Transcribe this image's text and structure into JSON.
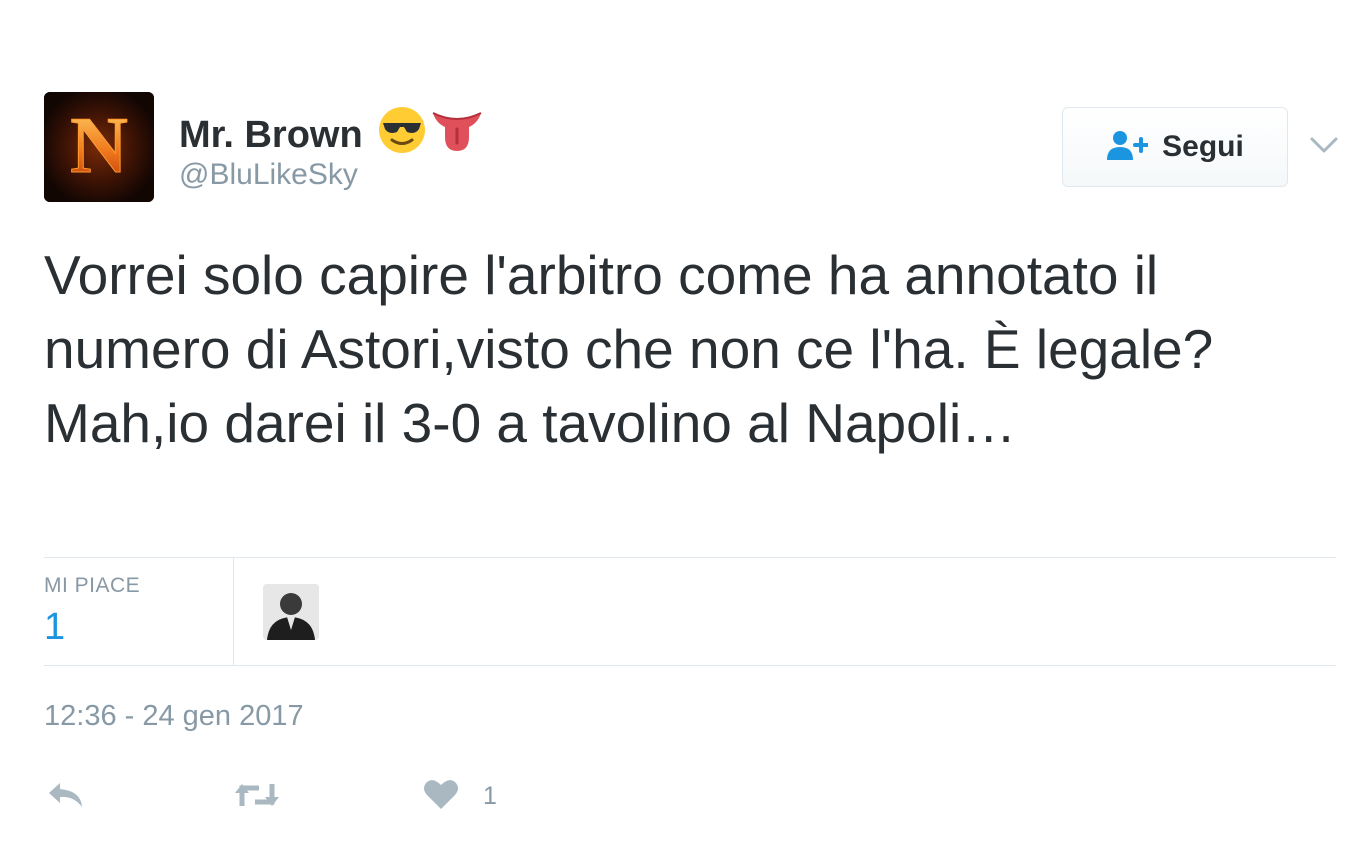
{
  "author": {
    "avatar_letter": "N",
    "name": "Mr. Brown",
    "emojis": [
      "sunglasses-emoji",
      "tongue-emoji"
    ],
    "handle": "@BluLikeSky"
  },
  "follow_button": {
    "label": "Segui",
    "icon": "add-user-icon"
  },
  "tweet": {
    "text": "Vorrei solo capire l'arbitro come ha annotato il numero di Astori,visto che non ce l'ha. È legale? Mah,io darei il 3-0 a tavolino al Napoli…"
  },
  "stats": {
    "likes_label": "MI PIACE",
    "likes_count": "1"
  },
  "timestamp": "12:36 - 24 gen 2017",
  "actions": {
    "reply_icon": "reply-icon",
    "retweet_icon": "retweet-icon",
    "like_icon": "heart-icon",
    "like_count": "1"
  },
  "colors": {
    "text": "#292f33",
    "muted": "#8899a6",
    "link": "#1b95e0",
    "border": "#e1e8ed"
  }
}
